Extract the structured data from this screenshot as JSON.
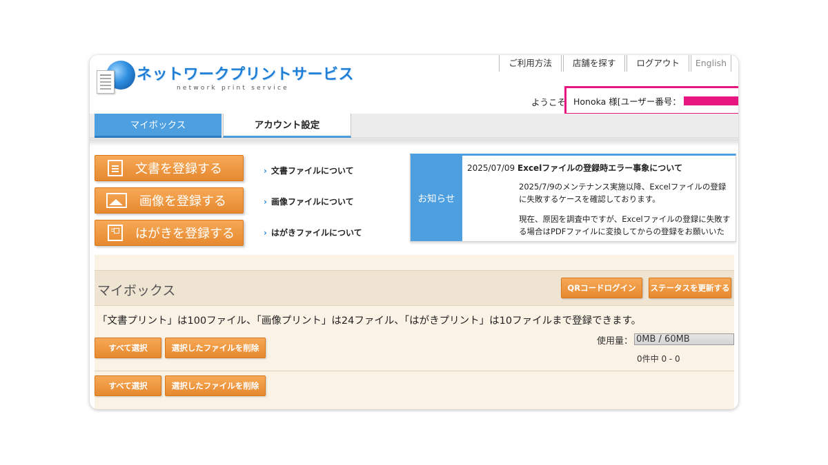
{
  "header": {
    "logo_title": "ネットワークプリントサービス",
    "logo_subtitle": "network print service",
    "links": [
      "ご利用方法",
      "店舗を探す",
      "ログアウト",
      "English"
    ],
    "welcome": "ようこそ",
    "user_text": "Honoka 様[ユーザー番号："
  },
  "nav": {
    "tabs": [
      "マイボックス",
      "アカウント設定"
    ]
  },
  "register": {
    "buttons": [
      "文書を登録する",
      "画像を登録する",
      "はがきを登録する"
    ],
    "about_links": [
      "文書ファイルについて",
      "画像ファイルについて",
      "はがきファイルについて"
    ]
  },
  "notice": {
    "label": "お知らせ",
    "date": "2025/07/09",
    "title": "Excelファイルの登録時エラー事象について",
    "para1": "2025/7/9のメンテナンス実施以降、Excelファイルの登録に失敗するケースを確認しております。",
    "para2": "現在、原因を調査中ですが、Excelファイルの登録に失敗する場合はPDFファイルに変換してからの登録をお願いいた"
  },
  "mybox": {
    "title": "マイボックス",
    "qr_login": "QRコードログイン",
    "refresh_status": "ステータスを更新する",
    "limit_text": "「文書プリント」は100ファイル、「画像プリント」は24ファイル、「はがきプリント」は10ファイルまで登録できます。",
    "select_all": "すべて選択",
    "delete_selected": "選択したファイルを削除",
    "usage_label": "使用量：",
    "usage_value": "0MB / 60MB",
    "usage_fraction": 0,
    "count_text": "0件中 0 - 0"
  },
  "colors": {
    "accent_blue": "#4d9fe0",
    "orange": "#f0993f",
    "redaction_pink": "#e6157f"
  }
}
